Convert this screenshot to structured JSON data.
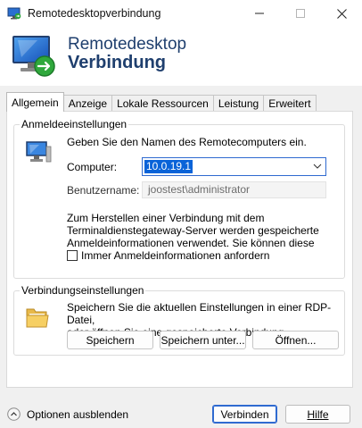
{
  "window": {
    "title": "Remotedesktopverbindung"
  },
  "banner": {
    "line1": "Remotedesktop",
    "line2": "Verbindung"
  },
  "tabs": [
    {
      "label": "Allgemein",
      "active": true
    },
    {
      "label": "Anzeige",
      "active": false
    },
    {
      "label": "Lokale Ressourcen",
      "active": false
    },
    {
      "label": "Leistung",
      "active": false
    },
    {
      "label": "Erweitert",
      "active": false
    }
  ],
  "logon": {
    "legend": "Anmeldeeinstellungen",
    "intro": "Geben Sie den Namen des Remotecomputers ein.",
    "computer_label": "Computer:",
    "computer_value": "10.0.19.1",
    "username_label": "Benutzername:",
    "username_value": "joostest\\administrator",
    "info_line1": "Zum Herstellen einer Verbindung mit dem",
    "info_line2": "Terminaldienstegateway-Server werden gespeicherte",
    "info_line3": "Anmeldeinformationen verwendet. Sie können diese",
    "always_ask_label": "Immer Anmeldeinformationen anfordern"
  },
  "connection": {
    "legend": "Verbindungseinstellungen",
    "desc_line1": "Speichern Sie die aktuellen Einstellungen in einer RDP-Datei,",
    "desc_line2": "oder öffnen Sie eine gespeicherte Verbindung.",
    "save_label": "Speichern",
    "save_as_label": "Speichern unter...",
    "open_label": "Öffnen..."
  },
  "footer": {
    "options_label": "Optionen ausblenden",
    "connect_label": "Verbinden",
    "help_label": "Hilfe"
  },
  "colors": {
    "banner_text": "#1f3f6e",
    "accent": "#2f6ad0",
    "selection": "#0a63d8"
  },
  "icons": {
    "app": "remote-desktop-icon",
    "computer": "computer-icon",
    "folder": "folder-icon",
    "options": "chevron-up-icon"
  }
}
